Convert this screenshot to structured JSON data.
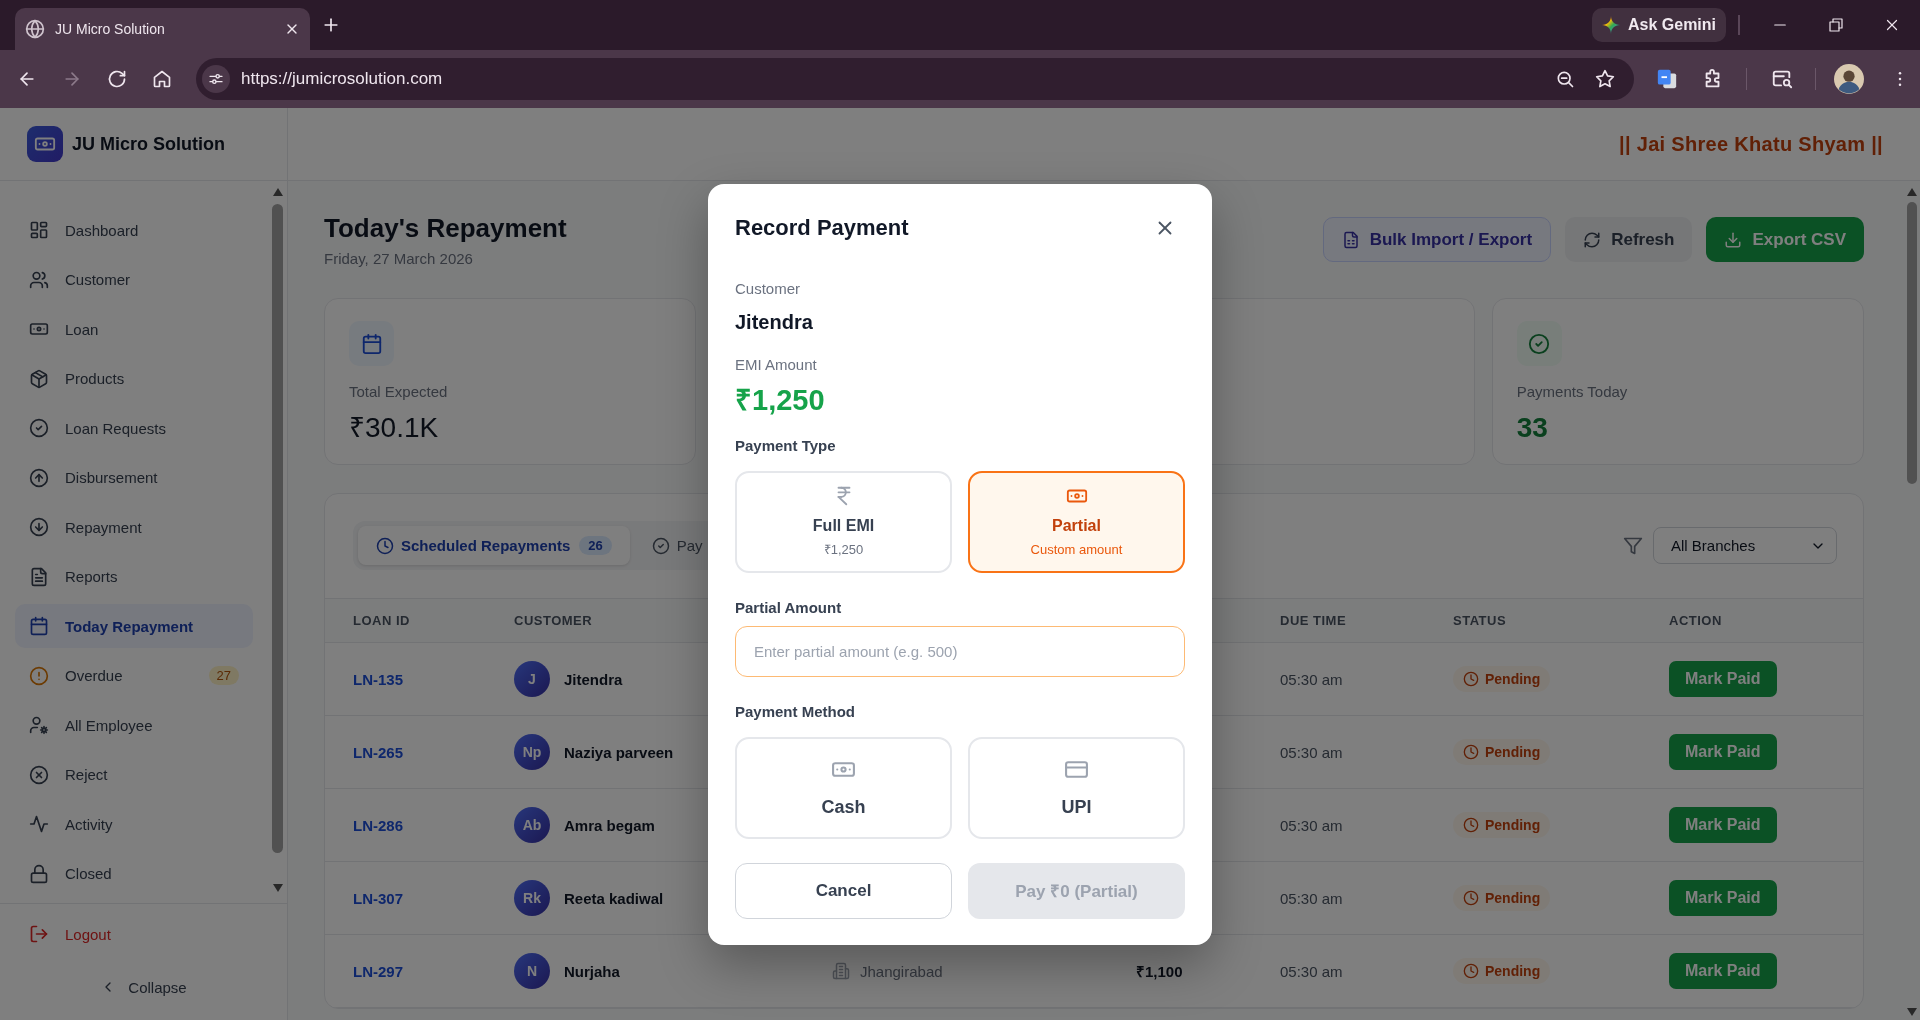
{
  "browser": {
    "tab_title": "JU Micro Solution",
    "assistant_button": "Ask Gemini",
    "url": "https://jumicrosolution.com"
  },
  "sidebar": {
    "brand": "JU Micro Solution",
    "items": [
      {
        "label": "Dashboard",
        "kind": "nav",
        "selected": false
      },
      {
        "label": "Customer",
        "kind": "nav",
        "selected": false
      },
      {
        "label": "Loan",
        "kind": "nav",
        "selected": false
      },
      {
        "label": "Products",
        "kind": "nav",
        "selected": false
      },
      {
        "label": "Loan Requests",
        "kind": "nav",
        "selected": false
      },
      {
        "label": "Disbursement",
        "kind": "nav",
        "selected": false
      },
      {
        "label": "Repayment",
        "kind": "nav",
        "selected": false
      },
      {
        "label": "Reports",
        "kind": "nav",
        "selected": false
      },
      {
        "label": "Today Repayment",
        "kind": "nav",
        "selected": true
      },
      {
        "label": "Overdue",
        "kind": "alert",
        "badge": "27",
        "selected": false
      },
      {
        "label": "All Employee",
        "kind": "nav",
        "selected": false
      },
      {
        "label": "Reject",
        "kind": "nav",
        "selected": false
      },
      {
        "label": "Activity",
        "kind": "nav",
        "selected": false
      },
      {
        "label": "Closed",
        "kind": "nav",
        "selected": false
      }
    ],
    "logout": "Logout",
    "collapse": "Collapse"
  },
  "header": {
    "banner": "|| Jai Shree Khatu Shyam ||"
  },
  "page": {
    "title": "Today's Repayment",
    "date": "Friday, 27 March 2026",
    "actions": [
      {
        "kind": "import",
        "label": "Bulk Import / Export"
      },
      {
        "kind": "refresh",
        "label": "Refresh"
      },
      {
        "kind": "export",
        "label": "Export CSV"
      }
    ]
  },
  "stat_cards": [
    {
      "kind": "expected",
      "label": "Total Expected",
      "value": "₹30.1K"
    },
    {
      "kind": "payments",
      "label": "Payments Today",
      "value": "33"
    }
  ],
  "tabs": [
    {
      "label": "Scheduled Repayments",
      "count": "26",
      "selected": true
    },
    {
      "label": "Pay",
      "selected": false
    }
  ],
  "branch_filter": {
    "value": "All Branches"
  },
  "table": {
    "columns": [
      "LOAN ID",
      "CUSTOMER",
      "DUE TIME",
      "STATUS",
      "ACTION"
    ],
    "rows": [
      {
        "loan_id": "LN-135",
        "initials": "J",
        "customer": "Jitendra",
        "due_time": "05:30 am",
        "status": "Pending",
        "action": "Mark Paid"
      },
      {
        "loan_id": "LN-265",
        "initials": "Np",
        "customer": "Naziya parveen",
        "due_time": "05:30 am",
        "status": "Pending",
        "action": "Mark Paid"
      },
      {
        "loan_id": "LN-286",
        "initials": "Ab",
        "customer": "Amra begam",
        "due_time": "05:30 am",
        "status": "Pending",
        "action": "Mark Paid"
      },
      {
        "loan_id": "LN-307",
        "initials": "Rk",
        "customer": "Reeta kadiwal",
        "due_time": "05:30 am",
        "status": "Pending",
        "action": "Mark Paid"
      },
      {
        "loan_id": "LN-297",
        "initials": "N",
        "customer": "Nurjaha",
        "branch": "Jhangirabad",
        "amount": "₹1,100",
        "due_time": "05:30 am",
        "status": "Pending",
        "action": "Mark Paid"
      }
    ]
  },
  "modal": {
    "title": "Record Payment",
    "customer_label": "Customer",
    "customer": "Jitendra",
    "emi_label": "EMI Amount",
    "emi_amount": "₹1,250",
    "payment_type_label": "Payment Type",
    "payment_types": [
      {
        "kind": "full",
        "title": "Full EMI",
        "subtitle": "₹1,250",
        "selected": false
      },
      {
        "kind": "partial",
        "title": "Partial",
        "subtitle": "Custom amount",
        "selected": true
      }
    ],
    "amount_label": "Partial Amount",
    "amount_field": {
      "placeholder": "Enter partial amount (e.g. 500)"
    },
    "payment_method_label": "Payment Method",
    "payment_methods": [
      {
        "kind": "cash",
        "label": "Cash",
        "selected": false
      },
      {
        "kind": "upi",
        "label": "UPI",
        "selected": false
      }
    ],
    "actions": [
      {
        "kind": "cancel",
        "label": "Cancel",
        "disabled": false
      },
      {
        "kind": "submit",
        "label": "Pay ₹0 (Partial)",
        "disabled": true
      }
    ]
  }
}
